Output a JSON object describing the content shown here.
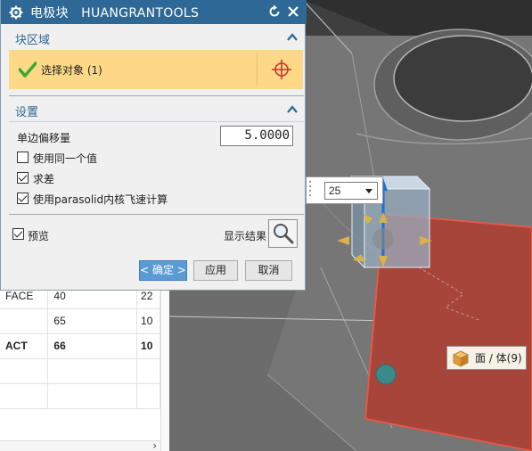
{
  "dialog": {
    "title": "电极块   HUANGRANTOOLS",
    "block_section": {
      "header": "块区域",
      "select_label": "选择对象 (1)"
    },
    "settings_section": {
      "header": "设置",
      "offset_label": "单边偏移量",
      "offset_value": "5.0000",
      "use_same_value": {
        "label": "使用同一个值",
        "checked": false
      },
      "subtract": {
        "label": "求差",
        "checked": true
      },
      "use_parasolid": {
        "label": "使用parasolid内核飞速计算",
        "checked": true
      }
    },
    "preview": {
      "label": "预览",
      "checked": true
    },
    "show_result_label": "显示结果",
    "buttons": {
      "ok": "< 确定 >",
      "apply": "应用",
      "cancel": "取消"
    }
  },
  "handle_widget": {
    "selected": "25"
  },
  "tooltip": {
    "text": "面 / 体(9)"
  },
  "table": {
    "rows": [
      {
        "c1": "FACE",
        "c2": "40",
        "c3": "22",
        "bold": false
      },
      {
        "c1": "",
        "c2": "65",
        "c3": "10",
        "bold": false
      },
      {
        "c1": "ACT",
        "c2": "66",
        "c3": "10",
        "bold": true
      },
      {
        "c1": "",
        "c2": "",
        "c3": "",
        "bold": false
      },
      {
        "c1": "",
        "c2": "",
        "c3": "",
        "bold": false
      }
    ]
  },
  "colors": {
    "titlebar": "#2d6896",
    "selection_highlight": "#fdd886",
    "selected_face": "#a8453a",
    "ok_button": "#5b9bd5"
  },
  "icons": [
    "gear-icon",
    "reset-icon",
    "close-icon",
    "collapse-chevron-icon",
    "green-check-icon",
    "crosshair-icon",
    "magnifier-icon",
    "cube-icon",
    "dropdown-arrow-icon"
  ]
}
